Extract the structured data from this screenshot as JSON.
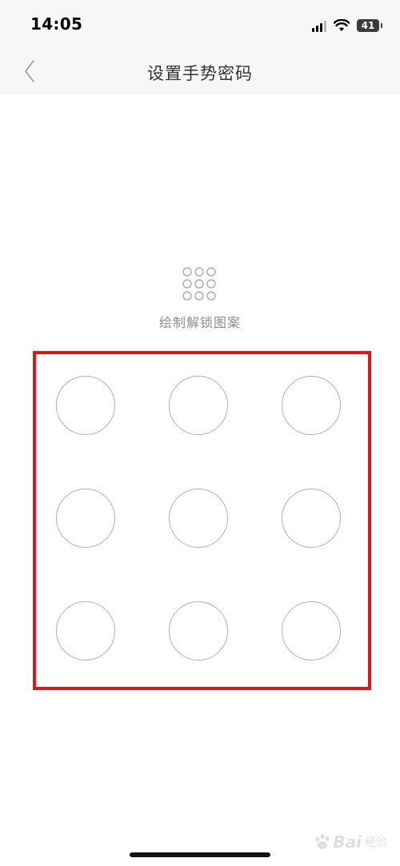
{
  "status_bar": {
    "time": "14:05",
    "battery_level": "41",
    "icons": [
      "cellular-signal-icon",
      "wifi-icon",
      "battery-icon"
    ]
  },
  "nav": {
    "back_icon": "chevron-left-icon",
    "title": "设置手势密码"
  },
  "hint": {
    "icon": "keypad-grid-icon",
    "text": "绘制解锁图案"
  },
  "pattern": {
    "rows": 3,
    "cols": 3,
    "dots": [
      1,
      2,
      3,
      4,
      5,
      6,
      7,
      8,
      9
    ]
  },
  "highlight": {
    "color": "#e01414"
  },
  "watermark": {
    "text": "Bai",
    "sub": "经验"
  },
  "colors": {
    "dot_border": "#aeaeae",
    "hint_text": "#8c8c8c",
    "title_text": "#333333",
    "bar_background": "#f7f7f7"
  }
}
